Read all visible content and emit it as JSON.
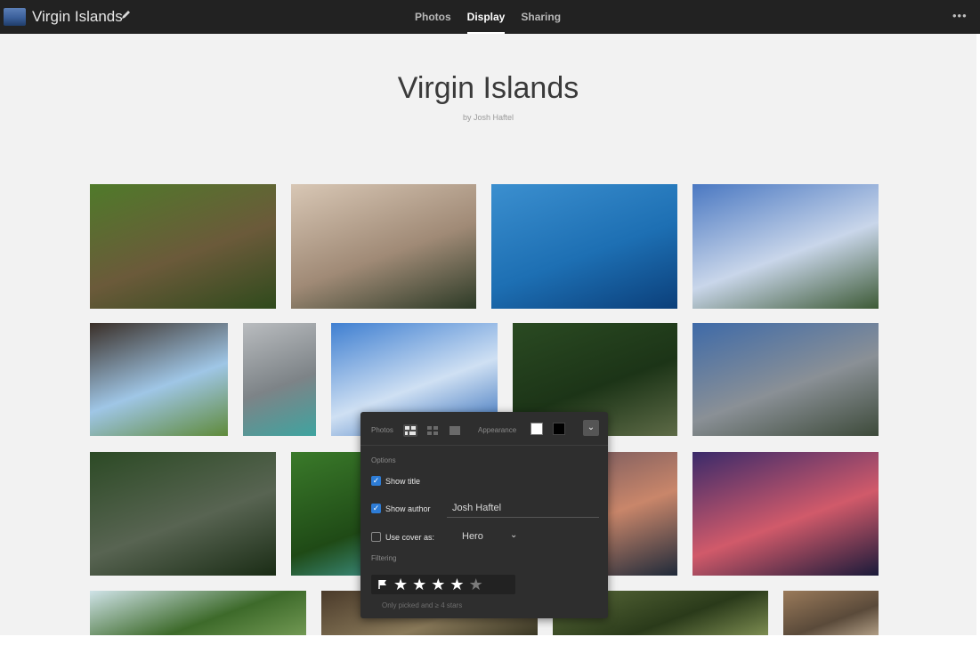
{
  "app": {
    "album_title": "Virgin Islands",
    "tabs": [
      {
        "label": "Photos",
        "active": false
      },
      {
        "label": "Display",
        "active": true
      },
      {
        "label": "Sharing",
        "active": false
      }
    ],
    "more_label": "•••"
  },
  "gallery": {
    "title": "Virgin Islands",
    "author_line": "by Josh Haftel"
  },
  "photos": [
    {
      "name": "photo-iguana",
      "colors": [
        "#4f7a2a",
        "#6b5a3a",
        "#2f4a1c"
      ]
    },
    {
      "name": "photo-sunset-harbor",
      "colors": [
        "#d8c7b5",
        "#a08a76",
        "#2c3a26"
      ]
    },
    {
      "name": "photo-blue-sea-swimmer",
      "colors": [
        "#3b8fcf",
        "#1d6fb3",
        "#0b3f7a"
      ]
    },
    {
      "name": "photo-clouds-bay",
      "colors": [
        "#4a78c2",
        "#c9d6ea",
        "#3d5a36"
      ]
    },
    {
      "name": "photo-stone-arch",
      "colors": [
        "#3a2f28",
        "#9fc6e6",
        "#5f8a3a"
      ]
    },
    {
      "name": "photo-storm-beach",
      "colors": [
        "#b9bcbf",
        "#7d8387",
        "#3fa4a0"
      ]
    },
    {
      "name": "photo-sky-clouds",
      "colors": [
        "#3f7fd1",
        "#cfe0f3",
        "#2f6ab8"
      ]
    },
    {
      "name": "photo-forest-stairs",
      "colors": [
        "#2a4a22",
        "#1c3417",
        "#5e6b47"
      ]
    },
    {
      "name": "photo-cairn-rocks",
      "colors": [
        "#3e6aa8",
        "#8a9096",
        "#3d4a3a"
      ]
    },
    {
      "name": "photo-forest-path",
      "colors": [
        "#2c4a25",
        "#586452",
        "#1a2c15"
      ]
    },
    {
      "name": "photo-palm-leaves",
      "colors": [
        "#3a7a2a",
        "#1f4a16",
        "#4fbac7"
      ]
    },
    {
      "name": "photo-dusk-clouds",
      "colors": [
        "#5a4a5a",
        "#c9866a",
        "#1f2a3a"
      ]
    },
    {
      "name": "photo-pink-sunset",
      "colors": [
        "#3a2a6a",
        "#d15a6a",
        "#1a1a3a"
      ]
    },
    {
      "name": "photo-tree-canopy",
      "colors": [
        "#cfe3e8",
        "#3d6a2a",
        "#7aa05a"
      ]
    },
    {
      "name": "photo-rocks-bottom",
      "colors": [
        "#4a3a2a",
        "#8a7a5a",
        "#2a2a1a"
      ]
    },
    {
      "name": "photo-grass-bottom",
      "colors": [
        "#5a6a3a",
        "#2a3a1a",
        "#8a9a5a"
      ]
    },
    {
      "name": "photo-ruins-bottom",
      "colors": [
        "#9a7a5a",
        "#5a4a3a",
        "#c9b59a"
      ]
    }
  ],
  "panel": {
    "photos_label": "Photos",
    "appearance_label": "Appearance",
    "options_label": "Options",
    "show_title_label": "Show title",
    "show_title_checked": true,
    "show_author_label": "Show author",
    "show_author_checked": true,
    "author_value": "Josh Haftel",
    "use_cover_label": "Use cover as:",
    "use_cover_checked": false,
    "cover_value": "Hero",
    "filtering_label": "Filtering",
    "rating_stars": 4,
    "rating_max": 5,
    "filter_note": "Only picked and ≥ 4 stars",
    "appearance_options": [
      "#ffffff",
      "#000000"
    ]
  }
}
